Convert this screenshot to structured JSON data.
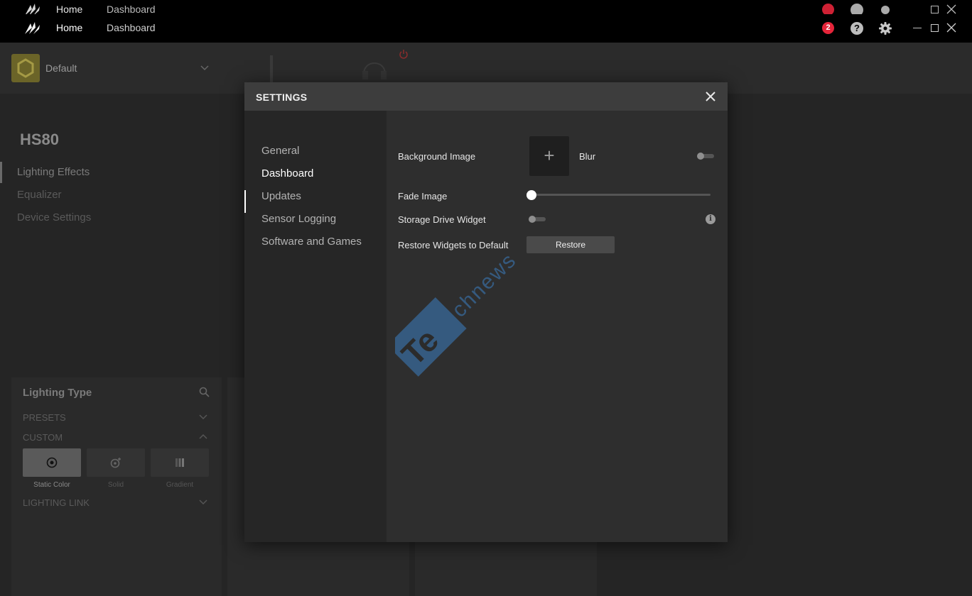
{
  "titlebar": {
    "nav_home": "Home",
    "nav_dashboard": "Dashboard",
    "notification_count": "2",
    "help_glyph": "?",
    "icons": [
      "corsair-logo-icon",
      "notification-badge",
      "help-icon",
      "gear-icon",
      "minimize-icon",
      "maximize-icon",
      "close-icon"
    ]
  },
  "background": {
    "profile_name": "Default",
    "device_title": "HS80",
    "sidebar": [
      "Lighting Effects",
      "Equalizer",
      "Device Settings"
    ],
    "lighting_type_title": "Lighting Type",
    "presets_label": "PRESETS",
    "custom_label": "CUSTOM",
    "lighting_link_label": "LIGHTING LINK",
    "tiles": [
      "Static Color",
      "Solid",
      "Gradient"
    ]
  },
  "settings_modal": {
    "title": "SETTINGS",
    "nav": [
      "General",
      "Dashboard",
      "Updates",
      "Sensor Logging",
      "Software and Games"
    ],
    "active_nav": "Dashboard",
    "background_image_label": "Background Image",
    "add_glyph": "+",
    "blur_label": "Blur",
    "blur_on": false,
    "fade_image_label": "Fade Image",
    "fade_image_value": 0,
    "storage_widget_label": "Storage Drive Widget",
    "storage_widget_on": false,
    "info_glyph": "i",
    "restore_label": "Restore Widgets to Default",
    "restore_button": "Restore"
  },
  "watermark": "Technews",
  "colors": {
    "badge": "#e5253a",
    "profile_icon": "#6b6428",
    "watermark": "#3b7ec2"
  }
}
